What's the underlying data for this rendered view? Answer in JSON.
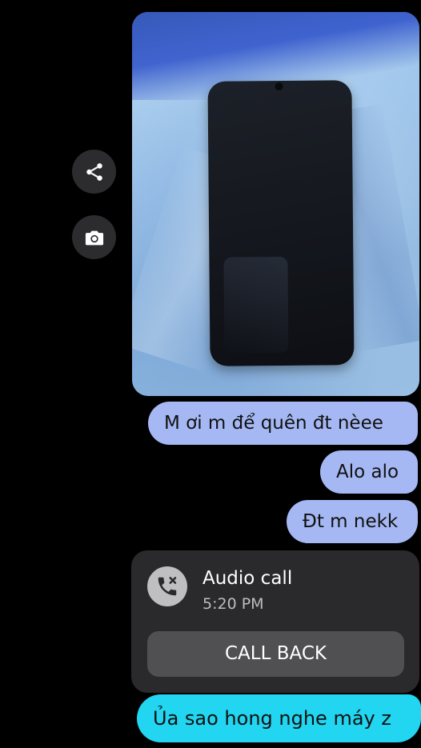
{
  "actions": {
    "share_icon": "share-icon",
    "camera_icon": "camera-icon"
  },
  "messages": [
    {
      "text": "M ơi m để quên đt nèee"
    },
    {
      "text": "Alo alo"
    },
    {
      "text": "Đt m nekk"
    }
  ],
  "call": {
    "title": "Audio call",
    "time": "5:20 PM",
    "button": "CALL BACK",
    "icon": "missed-call-icon"
  },
  "last_message": {
    "text": "Ủa sao hong nghe máy z"
  },
  "colors": {
    "bubble_sent": "#a5b8f3",
    "bubble_last": "#22d5f0",
    "call_card": "#2a2a2c",
    "call_button": "#505052",
    "background": "#000000"
  }
}
